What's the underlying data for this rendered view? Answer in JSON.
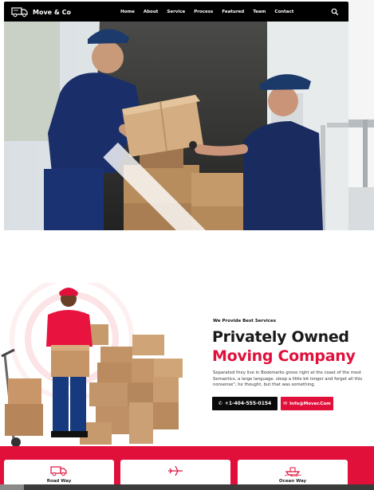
{
  "brand": {
    "name": "Move & Co",
    "icon": "truck-icon"
  },
  "nav": {
    "items": [
      "Home",
      "About",
      "Service",
      "Process",
      "Featured",
      "Team",
      "Contact"
    ],
    "search_icon": "search-icon"
  },
  "hero": {
    "image": "movers-loading-van-photo",
    "next_icon": "chevron-right-icon"
  },
  "about": {
    "tagline": "We Provide Best Services",
    "headline_line1": "Privately Owned",
    "headline_line2": "Moving Company",
    "body": "Separated they live in Bookmarks grove right at the coast of the most Semantics, a large language. sleep a little bit longer and forget all this nonsense\", he thought, but that was something.",
    "phone_label": "+1-404-555-0154",
    "email_label": "Info@Mover.Com"
  },
  "services": [
    {
      "label": "Road Way",
      "icon": "truck-icon"
    },
    {
      "label": "",
      "icon": "airplane-icon"
    },
    {
      "label": "Ocean Way",
      "icon": "ship-icon"
    }
  ],
  "colors": {
    "accent": "#e0103b",
    "dark": "#000000",
    "navy": "#1d2a5a"
  }
}
